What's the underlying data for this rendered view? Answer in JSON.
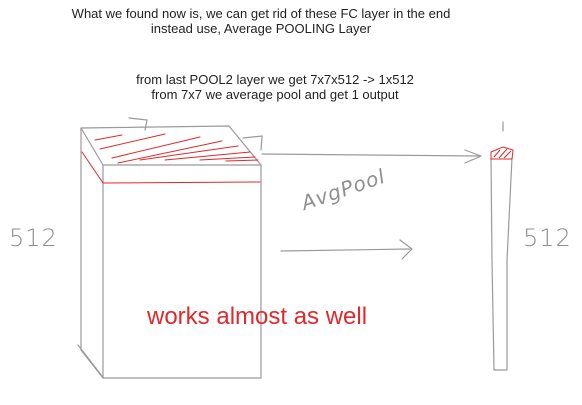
{
  "intro": {
    "line1": "What we found now is, we can get rid of these FC layer in the end",
    "line2": "instead use, Average POOLING Layer"
  },
  "note": {
    "line1": "from last POOL2 layer we get 7x7x512  -> 1x512",
    "line2": "from 7x7 we average pool and get 1 output"
  },
  "sketch": {
    "left_depth_label": "512",
    "right_depth_label": "512",
    "arrow_label": "AvgPool",
    "caption": "works almost as well"
  },
  "colors": {
    "ink": "#8f8f8f",
    "red_ink": "#e0292b",
    "text": "#222222"
  }
}
